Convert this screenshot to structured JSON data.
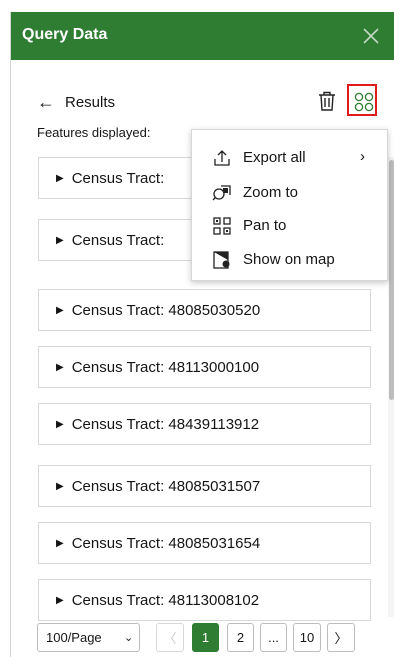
{
  "header": {
    "title": "Query Data",
    "close_icon": "close-icon"
  },
  "results": {
    "back_label": "Results",
    "features_label": "Features displayed:"
  },
  "items": [
    {
      "label": "Census Tract:"
    },
    {
      "label": "Census Tract:"
    },
    {
      "label": "Census Tract: 48085030520"
    },
    {
      "label": "Census Tract: 48113000100"
    },
    {
      "label": "Census Tract: 48439113912"
    },
    {
      "label": "Census Tract: 48085031507"
    },
    {
      "label": "Census Tract: 48085031654"
    },
    {
      "label": "Census Tract: 48113008102"
    }
  ],
  "menu": {
    "items": [
      {
        "label": "Export all",
        "icon": "export-icon",
        "submenu": true
      },
      {
        "label": "Zoom to",
        "icon": "zoom-to-icon"
      },
      {
        "label": "Pan to",
        "icon": "pan-to-icon"
      },
      {
        "label": "Show on map",
        "icon": "show-on-map-icon"
      }
    ]
  },
  "pagination": {
    "page_size": "100/Page",
    "pages": [
      "1",
      "2",
      "...",
      "10"
    ],
    "current_page": "1"
  },
  "colors": {
    "header_bg": "#2f7d32",
    "highlight": "#e01b1b"
  }
}
